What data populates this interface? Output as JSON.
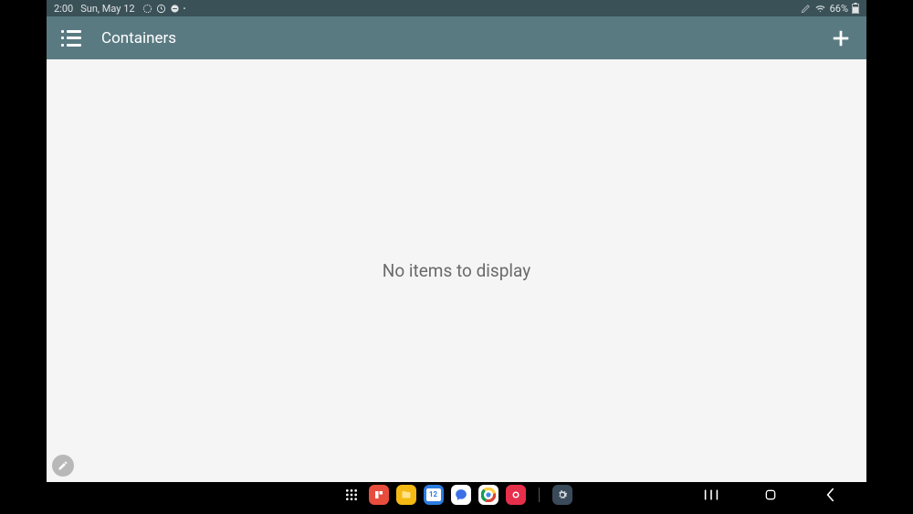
{
  "status": {
    "time": "2:00",
    "date": "Sun, May 12",
    "battery": "66%"
  },
  "appbar": {
    "title": "Containers"
  },
  "content": {
    "empty_message": "No items to display"
  },
  "dock": {
    "calendar_day": "12"
  }
}
